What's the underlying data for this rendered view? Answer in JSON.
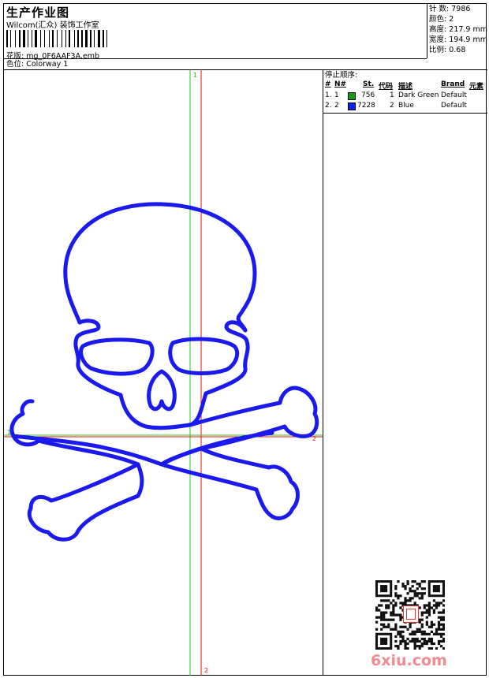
{
  "header": {
    "title": "生产作业图",
    "company": "Wilcom(汇众) 装饰工作室",
    "design_label": "花版:",
    "design_value": "mg_0F6AAF3A.emb",
    "colorway_label": "色位:",
    "colorway_value": "Colorway 1"
  },
  "stats": {
    "stitches_label": "针 数:",
    "stitches_value": "7986",
    "colors_label": "颜色:",
    "colors_value": "2",
    "height_label": "高度:",
    "height_value": "217.9 mm",
    "width_label": "宽度:",
    "width_value": "194.9 mm",
    "scale_label": "比例:",
    "scale_value": "0.68"
  },
  "stop_sequence": {
    "title": "停止顺序:",
    "headers": {
      "hash": "#",
      "no": "N#",
      "st": "St.",
      "code": "代码",
      "desc": "描述",
      "brand": "Brand",
      "element": "元素"
    },
    "rows": [
      {
        "idx": "1.",
        "n": "1",
        "color": "#119911",
        "st": "756",
        "code": "1",
        "desc": "Dark Green",
        "brand": "Default"
      },
      {
        "idx": "2.",
        "n": "2",
        "color": "#0a22ee",
        "st": "7228",
        "code": "2",
        "desc": "Blue",
        "brand": "Default"
      }
    ]
  },
  "design": {
    "marker_top": "1",
    "marker_left": "1",
    "marker_right": "2",
    "marker_bottom": "2",
    "stitch_color": "#1a1aee",
    "green_line": "#22cc22",
    "red_line": "#ee1111"
  },
  "watermark": "6xiu.com"
}
